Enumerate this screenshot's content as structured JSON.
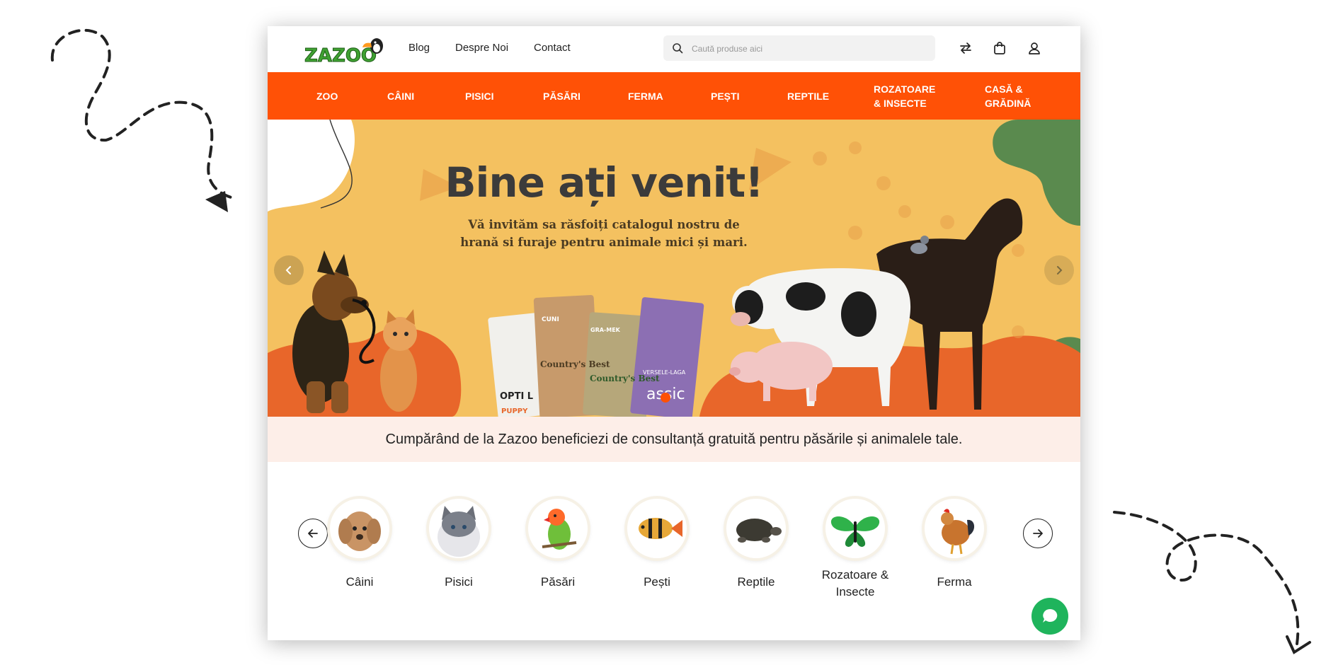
{
  "header": {
    "logo_text": "ZAZOO",
    "links": [
      "Blog",
      "Despre Noi",
      "Contact"
    ],
    "search_placeholder": "Caută produse aici",
    "icons": [
      "compare-arrows-icon",
      "shopping-bag-icon",
      "user-icon"
    ]
  },
  "nav": {
    "items": [
      "ZOO",
      "CÂINI",
      "PISICI",
      "PĂSĂRI",
      "FERMA",
      "PEȘTI",
      "REPTILE",
      [
        "ROZATOARE",
        "& INSECTE"
      ],
      [
        "CASĂ &",
        "GRĂDINĂ"
      ]
    ]
  },
  "hero": {
    "title": "Bine ați venit!",
    "subtitle_lines": [
      "Vă invităm sa răsfoiți catalogul nostru de",
      "hrană si furaje pentru animale mici și mari."
    ],
    "products": [
      "OPTI L",
      "PUPPY",
      "CUNI",
      "Country's Best",
      "Country's Best",
      "GRA-MEK",
      "VERSELE-LAGA",
      "assic"
    ]
  },
  "notice": "Cumpărând de la Zazoo beneficiezi de consultanță gratuită pentru păsările și animalele tale.",
  "categories": [
    {
      "label": "Câini",
      "icon": "dog-image"
    },
    {
      "label": "Pisici",
      "icon": "cat-image"
    },
    {
      "label": "Păsări",
      "icon": "parrot-image"
    },
    {
      "label": "Pești",
      "icon": "fish-image"
    },
    {
      "label": "Reptile",
      "icon": "turtle-image"
    },
    {
      "label": "Rozatoare & Insecte",
      "icon": "butterfly-image"
    },
    {
      "label": "Ferma",
      "icon": "rooster-image"
    }
  ],
  "colors": {
    "brand_orange": "#ff5106",
    "hero_yellow": "#f4c160",
    "notice_bg": "#fdeee8",
    "chat_green": "#1fb45c",
    "logo_green": "#3fa132"
  }
}
